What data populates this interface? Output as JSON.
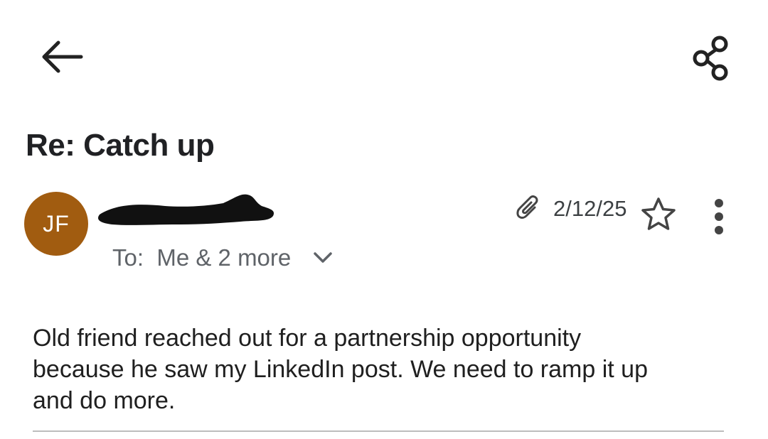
{
  "header": {
    "back_icon": "arrow-left-icon",
    "share_icon": "share-icon"
  },
  "email": {
    "subject": "Re: Catch up",
    "avatar_initials": "JF",
    "avatar_color": "#a15c10",
    "recipients_label": "To:  Me & 2 more",
    "attachment_icon": "paperclip-icon",
    "date": "2/12/25",
    "star_icon": "star-outline-icon",
    "more_icon": "more-vert-icon",
    "body": "Old friend reached out for a partnership opportunity\nbecause he saw my LinkedIn post.  We need to ramp it up\nand do more."
  },
  "colors": {
    "redaction": "#111111",
    "secondary_text": "#5f6368",
    "divider": "#bdbdbd"
  }
}
